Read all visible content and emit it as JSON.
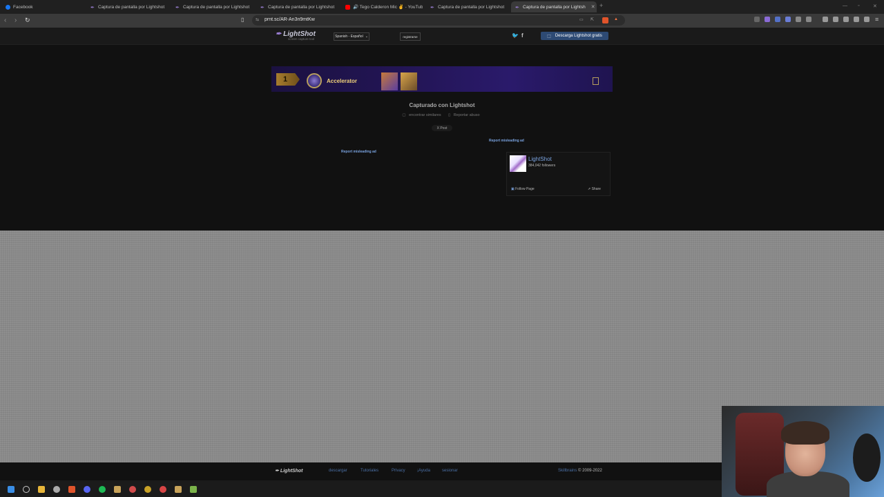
{
  "tabs": [
    {
      "title": "Facebook",
      "icon": "facebook-icon",
      "color": "#1877f2"
    },
    {
      "title": "Captura de pantalla por Lightshot",
      "icon": "lightshot-feather-icon",
      "color": "#9b7fd4"
    },
    {
      "title": "Captura de pantalla por Lightshot",
      "icon": "lightshot-feather-icon",
      "color": "#9b7fd4"
    },
    {
      "title": "Captura de pantalla por Lightshot",
      "icon": "lightshot-feather-icon",
      "color": "#9b7fd4"
    },
    {
      "title": "🔊 Tego Calderon Mic ✌ - YouTube",
      "icon": "youtube-icon",
      "color": "#ff0000"
    },
    {
      "title": "Captura de pantalla por Lightshot",
      "icon": "lightshot-feather-icon",
      "color": "#9b7fd4"
    },
    {
      "title": "Captura de pantalla por Lightsh",
      "icon": "lightshot-feather-icon",
      "color": "#9b7fd4",
      "active": true
    }
  ],
  "address_bar": {
    "url": "prnt.sc/AR-An3n9mtKw"
  },
  "site": {
    "logo_text": "LightShot",
    "logo_tagline": "screen capture tool",
    "language": "Spanish - Español",
    "register": "registrarse",
    "download_button": "Descarga Lightshot gratis"
  },
  "banner": {
    "rank": "1",
    "title": "Accelerator"
  },
  "capture": {
    "caption": "Capturado con Lightshot",
    "find_similar": "encontrar similares",
    "report_abuse": "Reportar abuso",
    "x_post": "X Post"
  },
  "ads": {
    "report_misleading": "Report misleading ad"
  },
  "facebook_widget": {
    "page_name": "LightShot",
    "followers": "384,042 followers",
    "follow": "Follow Page",
    "share": "Share"
  },
  "footer": {
    "logo": "LightShot",
    "links": [
      "descargar",
      "Tutoriales",
      "Privacy",
      "¡Ayuda",
      "sesionar"
    ],
    "company": "Skillbrains",
    "copyright": "© 2009-2022"
  },
  "colors": {
    "accent": "#2d4a74",
    "link": "#7aa3e0"
  }
}
